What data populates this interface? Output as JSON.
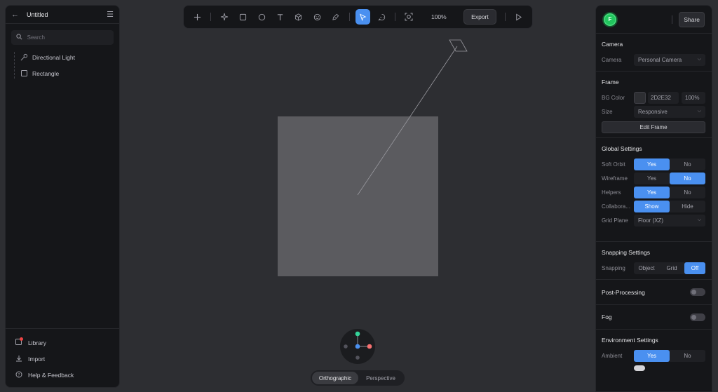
{
  "left": {
    "title": "Untitled",
    "search_placeholder": "Search",
    "tree": [
      {
        "label": "Directional Light",
        "icon": "light-icon"
      },
      {
        "label": "Rectangle",
        "icon": "rectangle-icon"
      }
    ],
    "footer": [
      {
        "label": "Library",
        "icon": "library-icon"
      },
      {
        "label": "Import",
        "icon": "import-icon"
      },
      {
        "label": "Help & Feedback",
        "icon": "help-icon"
      }
    ]
  },
  "toolbar": {
    "zoom": "100%",
    "export_label": "Export",
    "accent": "#4a90f0"
  },
  "view": {
    "orthographic": "Orthographic",
    "perspective": "Perspective",
    "active": "Orthographic"
  },
  "right": {
    "avatar_letter": "F",
    "share_label": "Share",
    "camera": {
      "title": "Camera",
      "label": "Camera",
      "value": "Personal Camera"
    },
    "frame": {
      "title": "Frame",
      "bg_label": "BG Color",
      "bg_hex": "2D2E32",
      "bg_opacity": "100%",
      "size_label": "Size",
      "size_value": "Responsive",
      "edit_label": "Edit Frame"
    },
    "global": {
      "title": "Global Settings",
      "soft_orbit": {
        "label": "Soft Orbit",
        "yes": "Yes",
        "no": "No"
      },
      "wireframe": {
        "label": "Wireframe",
        "yes": "Yes",
        "no": "No"
      },
      "helpers": {
        "label": "Helpers",
        "yes": "Yes",
        "no": "No"
      },
      "collab": {
        "label": "Collabora...",
        "show": "Show",
        "hide": "Hide"
      },
      "grid_plane": {
        "label": "Grid Plane",
        "value": "Floor (XZ)"
      }
    },
    "snapping": {
      "title": "Snapping Settings",
      "label": "Snapping",
      "object": "Object",
      "grid": "Grid",
      "off": "Off"
    },
    "post": {
      "title": "Post-Processing"
    },
    "fog": {
      "title": "Fog"
    },
    "env": {
      "title": "Environment Settings",
      "ambient": {
        "label": "Ambient",
        "yes": "Yes",
        "no": "No"
      }
    }
  }
}
